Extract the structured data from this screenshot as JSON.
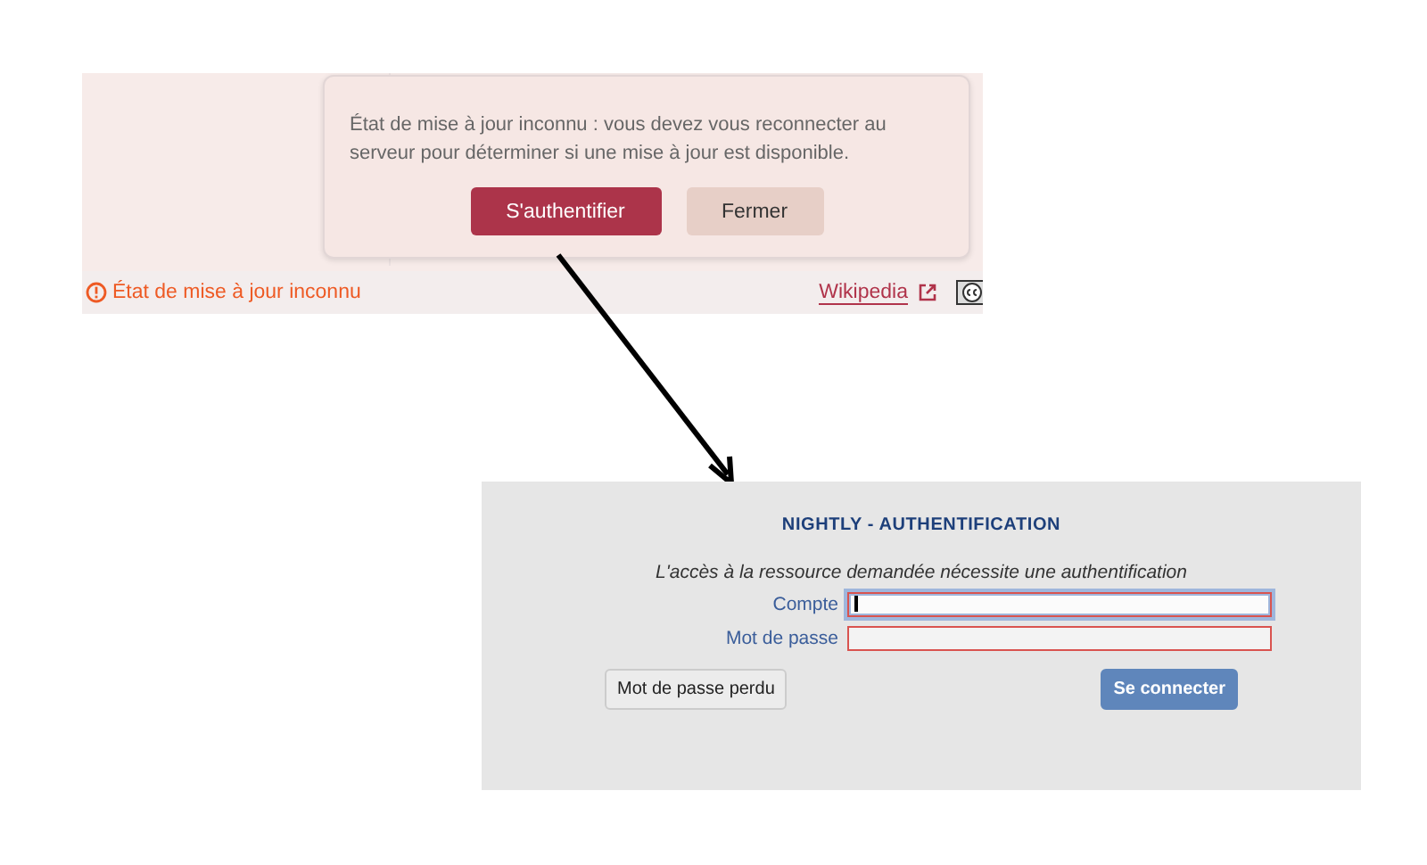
{
  "top_screenshot": {
    "popup": {
      "message": "État de mise à jour inconnu : vous devez vous reconnecter au serveur pour déterminer si une mise à jour est disponible.",
      "buttons": [
        {
          "label": "S'authentifier",
          "kind": "primary"
        },
        {
          "label": "Fermer",
          "kind": "secondary"
        }
      ]
    },
    "status": "État de mise à jour inconnu",
    "link": "Wikipedia"
  },
  "bottom_screenshot": {
    "title": "NIGHTLY - AUTHENTIFICATION",
    "message": "L'accès à la ressource demandée nécessite une authentification",
    "fields": [
      {
        "label": "Compte",
        "focused": true
      },
      {
        "label": "Mot de passe",
        "focused": false
      }
    ],
    "buttons": [
      {
        "label": "Mot de passe perdu",
        "kind": "secondary"
      },
      {
        "label": "Se connecter",
        "kind": "primary"
      }
    ]
  }
}
